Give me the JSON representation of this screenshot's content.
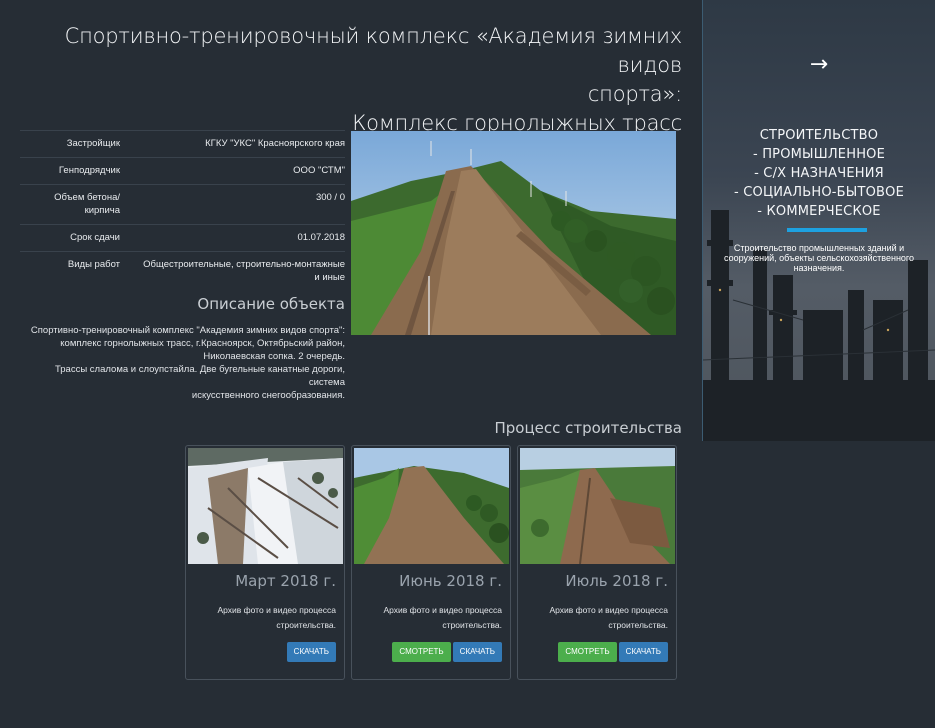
{
  "title": {
    "line1": "Спортивно-тренировочный комплекс «Академия зимних видов",
    "line2": "спорта»:",
    "line3": "Комплекс горнолыжных трасс"
  },
  "info": [
    {
      "key": "Застройщик",
      "value": "КГКУ \"УКС\" Красноярского края"
    },
    {
      "key": "Генподрядчик",
      "value": "ООО \"СТМ\""
    },
    {
      "key": "Объем бетона/кирпича",
      "value": "300 / 0"
    },
    {
      "key": "Срок сдачи",
      "value": "01.07.2018"
    },
    {
      "key": "Виды работ",
      "value": "Общестроительные, строительно-монтажные и иные"
    }
  ],
  "description": {
    "heading": "Описание объекта",
    "line1": "Спортивно-тренировочный комплекс \"Академия зимних видов спорта\":",
    "line2": "комплекс горнолыжных трасс, г.Красноярск, Октябрьский район,",
    "line3": "Николаевская сопка. 2 очередь.",
    "line4": "Трассы слалома и слоупстайла. Две бугельные канатные дороги, система",
    "line5": "искусственного снегообразования."
  },
  "process": {
    "heading": "Процесс строительства",
    "cards": [
      {
        "title": "Март 2018 г.",
        "text": "Архив фото и видео процесса строительства.",
        "view_label": "",
        "download_label": "Скачать"
      },
      {
        "title": "Июнь 2018 г.",
        "text": "Архив фото и видео процесса строительства.",
        "view_label": "Смотреть",
        "download_label": "Скачать"
      },
      {
        "title": "Июль 2018 г.",
        "text": "Архив фото и видео процесса строительства.",
        "view_label": "Смотреть",
        "download_label": "Скачать"
      }
    ]
  },
  "side": {
    "arrow": "→",
    "categories": [
      "СТРОИТЕЛЬСТВО",
      "- ПРОМЫШЛЕННОЕ",
      "- С/Х НАЗНАЧЕНИЯ",
      "- СОЦИАЛЬНО-БЫТОВОЕ",
      "- КОММЕРЧЕСКОЕ"
    ],
    "description": "Строительство промышленных зданий и сооружений, объекты сельскохозяйственного назначения.",
    "accent_color": "#1da1e0"
  },
  "colors": {
    "background": "#262d35",
    "button_green": "#4cae4c",
    "button_blue": "#337ab7"
  }
}
